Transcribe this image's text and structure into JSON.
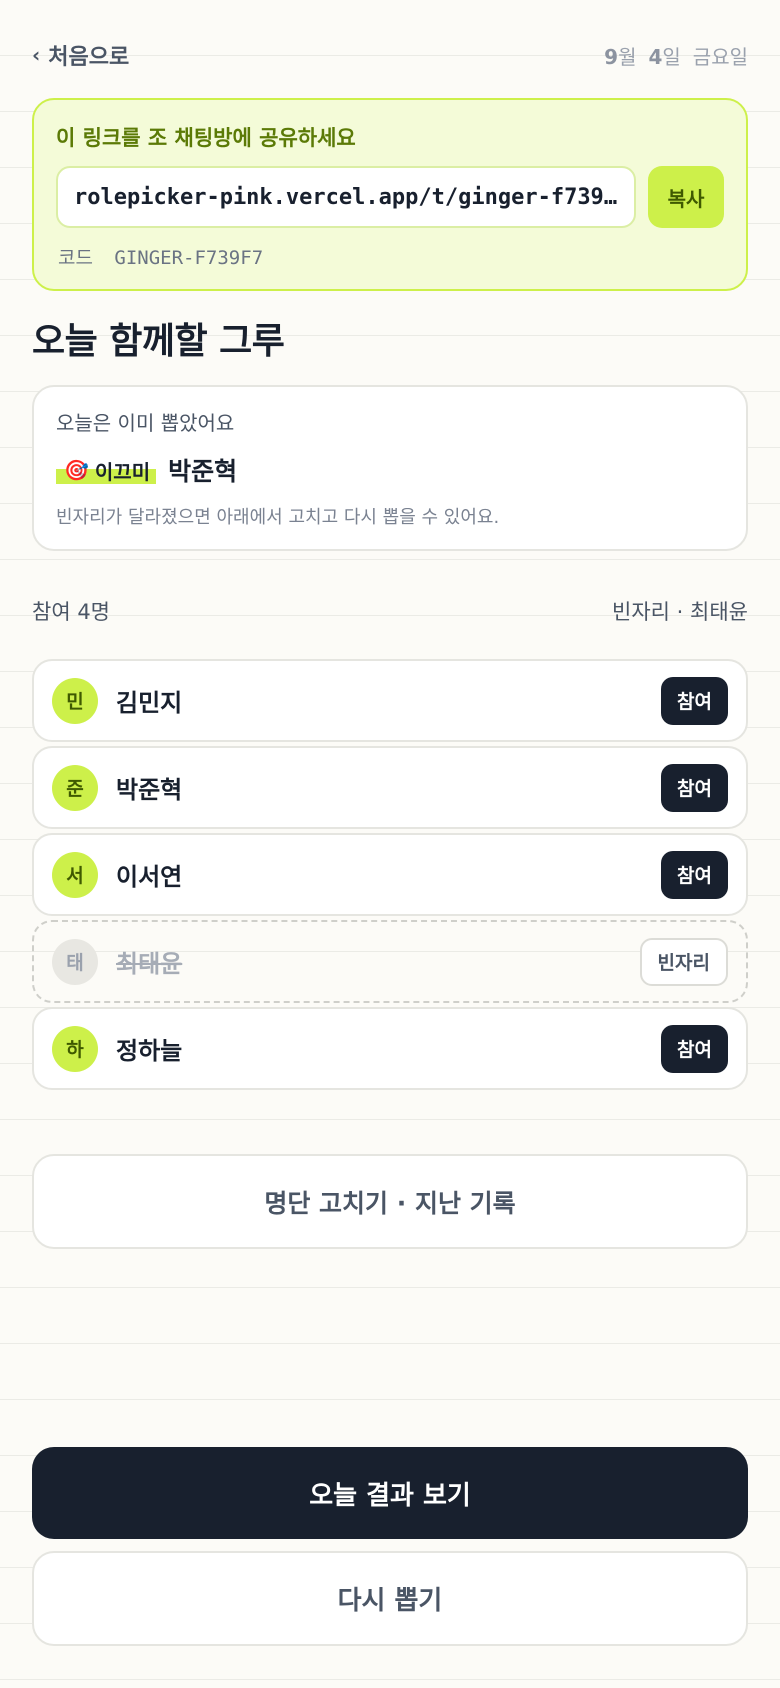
{
  "header": {
    "back_label": "처음으로",
    "date_month_num": "9",
    "date_month_unit": "월",
    "date_day_num": "4",
    "date_day_unit": "일",
    "date_weekday": "금요일"
  },
  "share": {
    "title": "이 링크를 조 채팅방에 공유하세요",
    "link": "rolepicker-pink.vercel.app/t/ginger-f739f7",
    "copy_label": "복사",
    "code_label": "코드",
    "code_value": "GINGER-F739F7"
  },
  "section_title": "오늘 함께할 그루",
  "result": {
    "heading": "오늘은 이미 뽑았어요",
    "badge_icon": "🎯",
    "badge_label": "이끄미",
    "picked_name": "박준혁",
    "note": "빈자리가 달라졌으면 아래에서 고치고 다시 뽑을 수 있어요."
  },
  "participants_header": {
    "count_label": "참여 4명",
    "vacant_label": "빈자리 · 최태윤"
  },
  "participants": [
    {
      "initial": "민",
      "name": "김민지",
      "status": "참여",
      "vacant": false
    },
    {
      "initial": "준",
      "name": "박준혁",
      "status": "참여",
      "vacant": false
    },
    {
      "initial": "서",
      "name": "이서연",
      "status": "참여",
      "vacant": false
    },
    {
      "initial": "태",
      "name": "최태윤",
      "status": "빈자리",
      "vacant": true
    },
    {
      "initial": "하",
      "name": "정하늘",
      "status": "참여",
      "vacant": false
    }
  ],
  "buttons": {
    "edit_roster": "명단 고치기 · 지난 기록",
    "view_result": "오늘 결과 보기",
    "redraw": "다시 뽑기"
  },
  "colors": {
    "accent": "#cdf04a",
    "dark": "#18202e",
    "background": "#fcfbf7"
  }
}
